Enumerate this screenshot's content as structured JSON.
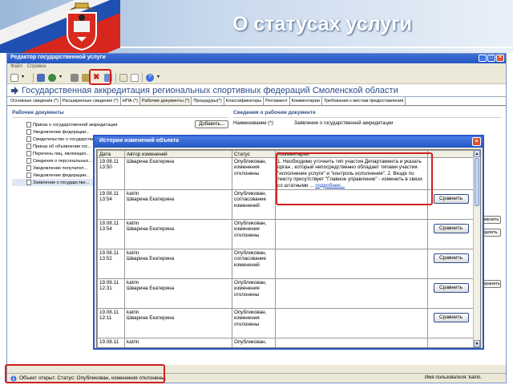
{
  "slide": {
    "title": "О статусах услуги"
  },
  "window": {
    "title": "Редактор государственной услуги",
    "menu": [
      "Файл",
      "Справка"
    ]
  },
  "document": {
    "title": "Государственная аккредитация региональных спортивных федераций Смоленской области"
  },
  "tabs": [
    "Основные сведения (*)",
    "Расширенные сведения (*)",
    "НПА (*)",
    "Рабочие документы (*)",
    "Процедуры(*)",
    "Классификаторы",
    "Регламент",
    "Комментарии",
    "Требования к местам предоставления"
  ],
  "left_panel": {
    "heading": "Рабочие документы",
    "add_button": "Добавить...",
    "items": [
      "Приказ о государственной аккредитации",
      "Уведомление федерации...",
      "Свидетельство о государственной...",
      "Приказ об объявлении гос...",
      "Перечень лиц, являющих...",
      "Сведения о персональных...",
      "Уведомление получател...",
      "Уведомление федерации...",
      "Заявление о государстве..."
    ]
  },
  "right_panel": {
    "heading": "Сведения о рабочем документе",
    "name_label": "Наименование (*):",
    "name_value": "Заявление о государственной аккредитации",
    "side_buttons": [
      "Заменить",
      "Удалить",
      "Сохранить"
    ]
  },
  "dialog": {
    "title": "История изменений объекта",
    "headers": {
      "date": "Дата",
      "author": "Автор изменений",
      "status": "Статус",
      "comment": "Комментарии"
    },
    "compare_label": "Сравнить",
    "more_label": "подробнее...",
    "rows": [
      {
        "date": "19.08.11 13:50",
        "login": "",
        "author": "Шварина Екатерина",
        "status": "Опубликован, изменения отклонены",
        "comment": "1. Необходимо уточнить тип участия Департамента и указать орган , который непосредственно обладает типами участия \"исполнение услуги\" и \"контроль исполнения\". 2. Везде по тексту присутствует \"Главное управление\" - изменить в связи со штатными ..."
      },
      {
        "date": "19.08.11 13:54",
        "login": "katrin",
        "author": "Шварина Екатерина",
        "status": "Опубликован, согласование изменений",
        "comment": ""
      },
      {
        "date": "19.08.11 13:54",
        "login": "katrin",
        "author": "Шварина Екатерина",
        "status": "Опубликован, изменения отклонены",
        "comment": ""
      },
      {
        "date": "19.08.11 13:52",
        "login": "katrin",
        "author": "Шварина Екатерина",
        "status": "Опубликован, согласование изменений",
        "comment": ""
      },
      {
        "date": "19.08.11 12:31",
        "login": "katrin",
        "author": "Шварина Екатерина",
        "status": "Опубликован, изменения отклонены",
        "comment": ""
      },
      {
        "date": "19.08.11 12:11",
        "login": "katrin",
        "author": "Шварина Екатерина",
        "status": "Опубликован, изменения отклонены",
        "comment": ""
      },
      {
        "date": "19.08.11",
        "login": "katrin",
        "author": "",
        "status": "Опубликован,",
        "comment": ""
      }
    ]
  },
  "statusbar": {
    "text": "Объект открыт. Статус: Опубликован, изменения отклонены.",
    "user": "Имя пользователя: katrin."
  },
  "colors": {
    "accent": "#2557c4",
    "highlight": "#d02020",
    "link": "#1a46c0"
  }
}
